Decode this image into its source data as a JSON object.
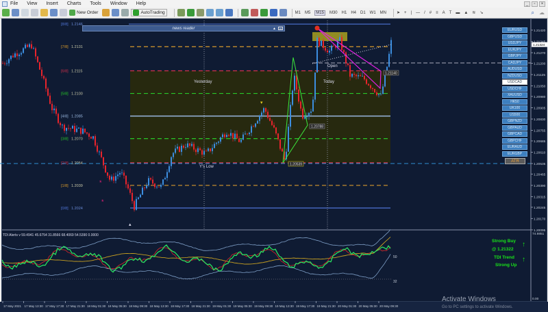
{
  "menu": [
    "File",
    "View",
    "Insert",
    "Charts",
    "Tools",
    "Window",
    "Help"
  ],
  "toolbar": {
    "new_order": "New Order",
    "autotrading": "AutoTrading",
    "timeframes": [
      "M1",
      "M5",
      "M15",
      "M30",
      "H1",
      "H4",
      "D1",
      "W1",
      "MN"
    ],
    "active_timeframe": "M15"
  },
  "news_reader": {
    "title": "news reader"
  },
  "symbols": [
    "EURUSD",
    "GBPUSD",
    "USDJPY",
    "EURJPY",
    "GBPJPY",
    "CADJPY",
    "AUDUSD",
    "NZDUSD",
    "USDCAD",
    "USDCHF",
    "XAUUSD",
    "HK50",
    "UK100",
    "US500",
    "GBPNZD",
    "GBPAUD",
    "GBPCAD",
    "GBPCHF",
    "EURAUD",
    "EURGBP"
  ],
  "selected_symbol": "USDCAD",
  "atr_label": "ATR",
  "murrey": [
    {
      "tag": "[8/8]",
      "price": "1.2146",
      "color": "#4f74d6",
      "p": 1.2146
    },
    {
      "tag": "[7/8]",
      "price": "1.2131",
      "color": "#d79a2c",
      "p": 1.2131
    },
    {
      "tag": "[6/8]",
      "price": "1.2115",
      "color": "#d2304a",
      "p": 1.2115
    },
    {
      "tag": "[5/8]",
      "price": "1.2100",
      "color": "#28c828",
      "p": 1.21
    },
    {
      "tag": "[4/8]",
      "price": "1.2085",
      "color": "#9ab8e0",
      "p": 1.2085
    },
    {
      "tag": "[3/8]",
      "price": "1.2070",
      "color": "#28c828",
      "p": 1.207
    },
    {
      "tag": "[2/8]",
      "price": "1.2054",
      "color": "#d2304a",
      "p": 1.2054
    },
    {
      "tag": "[1/8]",
      "price": "1.2039",
      "color": "#d79a2c",
      "p": 1.2039
    },
    {
      "tag": "[0/8]",
      "price": "1.2024",
      "color": "#4f74d6",
      "p": 1.2024
    }
  ],
  "chart_labels": {
    "yesterday": "Yesterday",
    "today": "Today",
    "open": "Open",
    "ys_low": "Y's Low",
    "zz_low": "1.20539",
    "zz_mid": "1.20788",
    "zz_right": "1.21140"
  },
  "price_axis": [
    "1.21420",
    "1.21345",
    "1.21270",
    "1.21200",
    "1.21125",
    "1.21050",
    "1.20980",
    "1.20905",
    "1.20830",
    "1.20755",
    "1.20685",
    "1.20610",
    "1.20535",
    "1.20465",
    "1.20390",
    "1.20315",
    "1.20245",
    "1.20170",
    "1.20095"
  ],
  "current_price": "1.21324",
  "indicator": {
    "header": "TDI Alerts v 59.4941 45.6754 31.8566 68.4069 54.5390 0.0000",
    "axis_top": "74.9851",
    "level_50": "50",
    "level_32": "32",
    "axis_bottom": "0.00"
  },
  "signals": {
    "line1": "Strong Buy",
    "line2": "@ 1.21322",
    "line3": "TDI Trend",
    "line4": "Strong Up"
  },
  "time_axis": [
    "17 May 2021",
    "17 May 13:30",
    "17 May 17:30",
    "17 May 21:30",
    "18 May 01:30",
    "18 May 05:30",
    "18 May 09:30",
    "18 May 13:30",
    "18 May 17:30",
    "18 May 21:30",
    "19 May 01:30",
    "19 May 05:30",
    "19 May 09:30",
    "19 May 13:30",
    "19 May 17:30",
    "19 May 21:30",
    "20 May 01:30",
    "20 May 05:30",
    "20 May 09:30"
  ],
  "watermark": {
    "title": "Activate Windows",
    "subtitle": "Go to PC settings to activate Windows."
  },
  "colors": {
    "bull": "#3c8ee0",
    "bear": "#e8242c",
    "bg": "#0f1b33",
    "box": "#27290f"
  }
}
